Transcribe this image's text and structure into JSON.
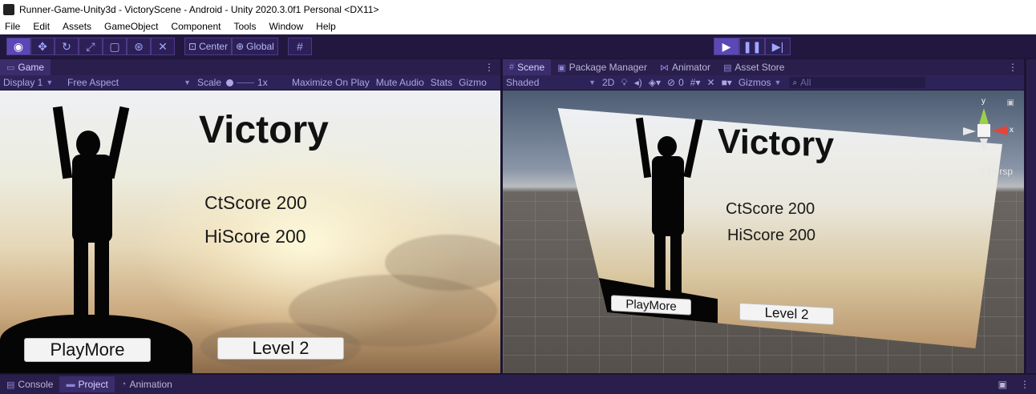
{
  "window": {
    "title": "Runner-Game-Unity3d - VictoryScene - Android - Unity 2020.3.0f1 Personal <DX11>"
  },
  "menu": [
    "File",
    "Edit",
    "Assets",
    "GameObject",
    "Component",
    "Tools",
    "Window",
    "Help"
  ],
  "toolbar": {
    "tools": [
      "view-icon",
      "move-icon",
      "rotate-icon",
      "scale-icon",
      "rect-icon",
      "transform-icon",
      "custom-tool-icon"
    ],
    "pivot_label": "Center",
    "space_label": "Global",
    "play_controls": [
      "play",
      "pause",
      "step"
    ]
  },
  "game_panel": {
    "tab_label": "Game",
    "display_label": "Display 1",
    "aspect_label": "Free Aspect",
    "scale_label": "Scale",
    "scale_value": "1x",
    "maximize_label": "Maximize On Play",
    "mute_label": "Mute Audio",
    "stats_label": "Stats",
    "gizmos_label": "Gizmo"
  },
  "scene_panel": {
    "tabs": [
      "Scene",
      "Package Manager",
      "Animator",
      "Asset Store"
    ],
    "shading_label": "Shaded",
    "mode_2d_label": "2D",
    "hidden_count": "0",
    "gizmos_label": "Gizmos",
    "search_placeholder": "All",
    "persp_label": "Persp",
    "axis_y": "y",
    "axis_x": "x"
  },
  "game_ui": {
    "title": "Victory",
    "current_score": "CtScore 200",
    "high_score": "HiScore 200",
    "play_more_label": "PlayMore",
    "level_label": "Level 2"
  },
  "bottom_tabs": [
    "Console",
    "Project",
    "Animation"
  ],
  "colors": {
    "editor_bg": "#22173f",
    "tab_active": "#3b2d6b",
    "accent": "#5b48b6",
    "gizmo_x": "#e2453a",
    "gizmo_y": "#9bd14a"
  }
}
